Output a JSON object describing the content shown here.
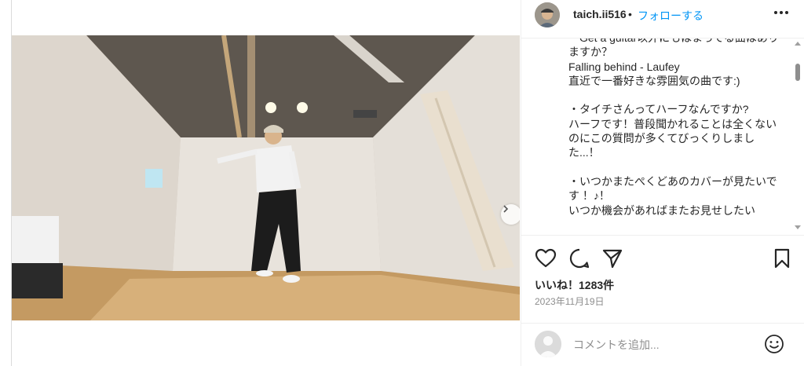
{
  "post": {
    "media_label": "Dance video",
    "carousel": {
      "count": 2,
      "active": 0
    }
  },
  "header": {
    "username": "taich.ii516",
    "separator": "•",
    "follow_label": "フォローする"
  },
  "caption": {
    "lines": [
      "・Get a guitar以外にもはまってる曲はありますか？",
      "Falling behind - Laufey",
      "直近で一番好きな雰囲気の曲です:)",
      "",
      "・タイチさんってハーフなんですか?",
      "ハーフです！普段聞かれることは全くないのにこの質問が多くてびっくりしました...！",
      "",
      "・いつかまたぺくどあのカバーが見たいです ！♪！",
      "いつか機会があればまたお見せしたい"
    ]
  },
  "icons": {
    "like": "heart-icon",
    "comment": "comment-icon",
    "share": "send-icon",
    "save": "bookmark-icon",
    "more": "more-icon",
    "next": "chevron-right-icon",
    "user_tag": "user-icon",
    "mute": "muted-speaker-icon",
    "emoji": "emoji-icon"
  },
  "stats": {
    "likes": "いいね！1283件",
    "date": "2023年11月19日"
  },
  "comment": {
    "placeholder": "コメントを追加..."
  },
  "colors": {
    "accent": "#0095f6",
    "text": "#262626",
    "muted": "#8e8e8e",
    "border": "#efefef"
  }
}
